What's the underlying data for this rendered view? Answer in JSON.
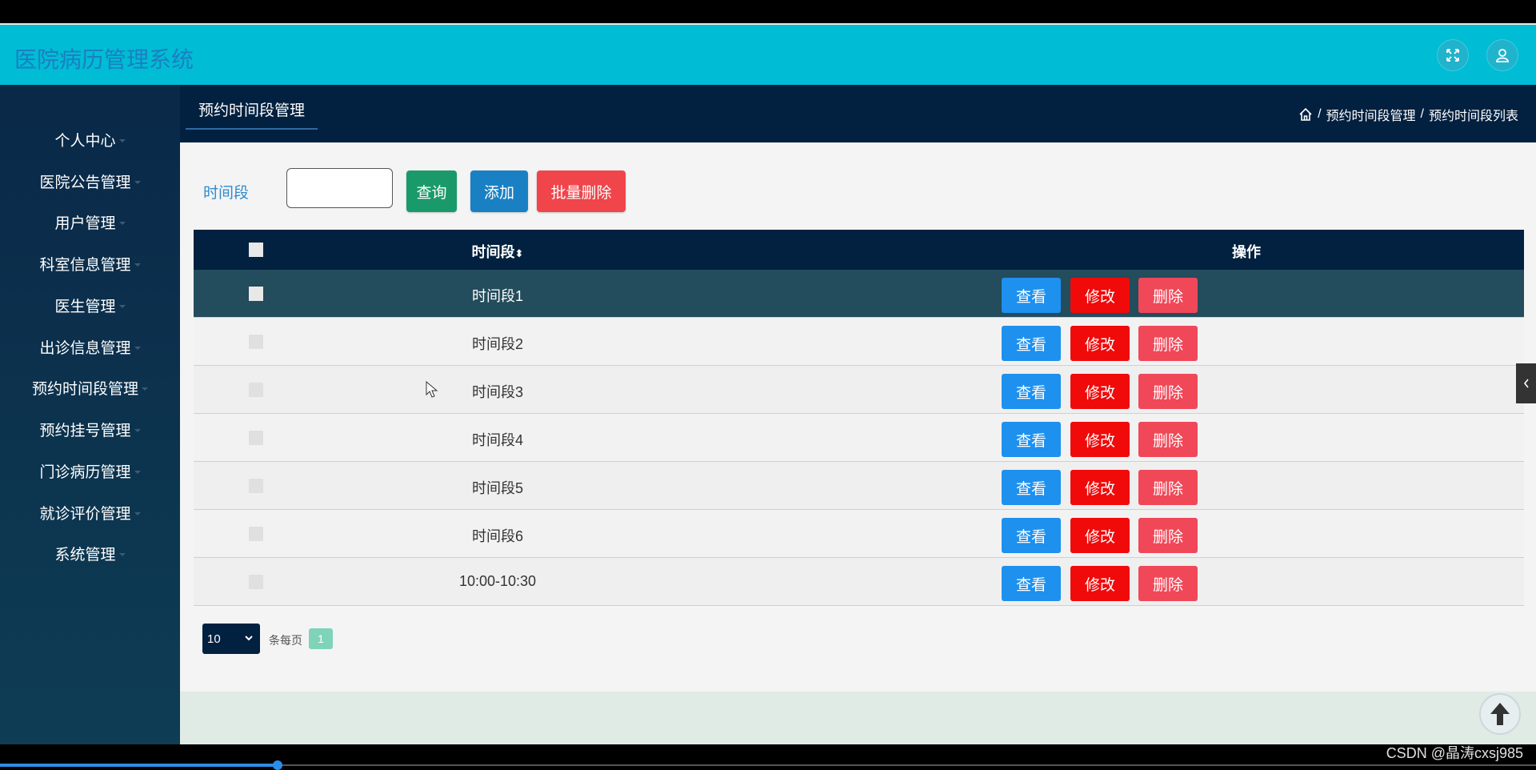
{
  "app": {
    "title": "医院病历管理系统"
  },
  "header_icons": [
    "fullscreen-icon",
    "user-icon"
  ],
  "sidebar": {
    "items": [
      {
        "label": "个人中心"
      },
      {
        "label": "医院公告管理"
      },
      {
        "label": "用户管理"
      },
      {
        "label": "科室信息管理"
      },
      {
        "label": "医生管理"
      },
      {
        "label": "出诊信息管理"
      },
      {
        "label": "预约时间段管理"
      },
      {
        "label": "预约挂号管理"
      },
      {
        "label": "门诊病历管理"
      },
      {
        "label": "就诊评价管理"
      },
      {
        "label": "系统管理"
      }
    ]
  },
  "page": {
    "tab_title": "预约时间段管理",
    "breadcrumb": [
      "预约时间段管理",
      "预约时间段列表"
    ]
  },
  "search": {
    "label": "时间段",
    "input_value": "",
    "query_label": "查询",
    "add_label": "添加",
    "batch_delete_label": "批量删除"
  },
  "table": {
    "columns": [
      "时间段",
      "操作"
    ],
    "sort_glyph": "⬍",
    "rows": [
      {
        "time": "时间段1"
      },
      {
        "time": "时间段2"
      },
      {
        "time": "时间段3"
      },
      {
        "time": "时间段4"
      },
      {
        "time": "时间段5"
      },
      {
        "time": "时间段6"
      },
      {
        "time": "10:00-10:30"
      }
    ],
    "actions": {
      "view": "查看",
      "edit": "修改",
      "delete": "删除"
    }
  },
  "pagination": {
    "page_size": "10",
    "per_page_text": "条每页",
    "current_page": "1"
  },
  "colors": {
    "header_bg": "#00bcd4",
    "sidebar_bg": "#0a2848",
    "query_btn": "#1a9a6a",
    "add_btn": "#1a80c4",
    "batch_delete_btn": "#f0454a",
    "view_btn": "#1e90ee",
    "edit_btn": "#f00a0a",
    "delete_btn": "#f04858",
    "page_badge": "#7fd3b8"
  },
  "watermark": "CSDN @晶涛cxsj985"
}
